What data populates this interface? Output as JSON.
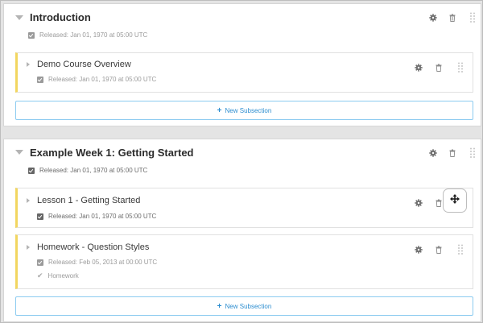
{
  "sections": [
    {
      "title": "Introduction",
      "status": "Released: Jan 01, 1970 at 05:00 UTC",
      "subsections": [
        {
          "title": "Demo Course Overview",
          "status": "Released: Jan 01, 1970 at 05:00 UTC"
        }
      ],
      "new_subsection_label": "New Subsection"
    },
    {
      "title": "Example Week 1: Getting Started",
      "status": "Released: Jan 01, 1970 at 05:00 UTC",
      "subsections": [
        {
          "title": "Lesson 1 - Getting Started",
          "status": "Released: Jan 01, 1970 at 05:00 UTC"
        },
        {
          "title": "Homework - Question Styles",
          "status": "Released: Feb 05, 2013 at 00:00 UTC",
          "grading": "Homework"
        }
      ],
      "new_subsection_label": "New Subsection"
    }
  ],
  "icons": {
    "expand_section": "caret-down-icon",
    "expand_subsection": "caret-right-icon",
    "settings": "gear-icon",
    "delete": "trash-icon",
    "drag": "drag-handle-icon",
    "move": "move-arrows-icon",
    "published": "checkbox-icon",
    "graded": "checkmark-icon"
  },
  "colors": {
    "subsection_accent": "#f2d660",
    "new_subsection_border": "#8ccbf0",
    "new_subsection_text": "#2d8ed0"
  }
}
